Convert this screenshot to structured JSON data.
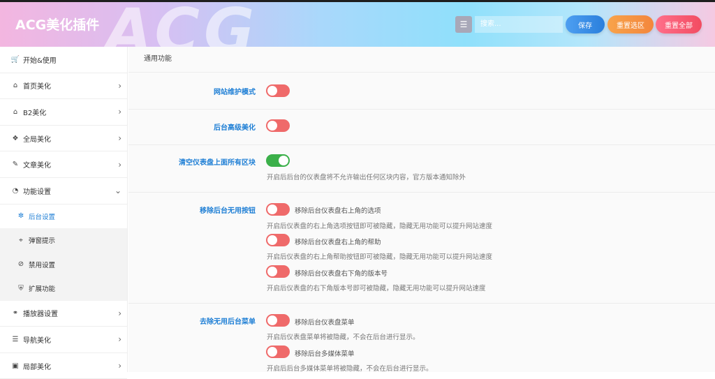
{
  "header": {
    "brand": "ACG美化插件",
    "watermark": "ACG",
    "search_placeholder": "搜索...",
    "menu_icon": "list-icon",
    "save_label": "保存",
    "reset_section_label": "重置选区",
    "reset_all_label": "重置全部"
  },
  "sidebar": {
    "items": [
      {
        "label": "开始&使用",
        "icon": "cart-icon"
      },
      {
        "label": "首页美化",
        "icon": "home-icon"
      },
      {
        "label": "B2美化",
        "icon": "home-icon"
      },
      {
        "label": "全局美化",
        "icon": "codepen-icon"
      },
      {
        "label": "文章美化",
        "icon": "edit-icon"
      },
      {
        "label": "功能设置",
        "icon": "pie-chart-icon"
      }
    ],
    "sub_items": [
      {
        "label": "后台设置",
        "icon": "spinner-icon",
        "active": true
      },
      {
        "label": "弹窗提示",
        "icon": "crop-icon"
      },
      {
        "label": "禁用设置",
        "icon": "ban-icon"
      },
      {
        "label": "扩展功能",
        "icon": "shield-icon"
      }
    ],
    "bottom_items": [
      {
        "label": "播放器设置",
        "icon": "headphones-icon"
      },
      {
        "label": "导航美化",
        "icon": "list-icon"
      },
      {
        "label": "局部美化",
        "icon": "frame-icon"
      }
    ]
  },
  "main": {
    "title": "通用功能",
    "settings": [
      {
        "label": "网站维护模式",
        "on": false
      },
      {
        "label": "后台高级美化",
        "on": false
      },
      {
        "label": "清空仪表盘上面所有区块",
        "on": true,
        "desc": "开启后后台的仪表盘将不允许输出任何区块内容，官方版本通知除外"
      },
      {
        "label": "移除后台无用按钮",
        "options": [
          {
            "text": "移除后台仪表盘右上角的选项",
            "desc": "开启后仪表盘的右上角选项按钮即可被隐藏，隐藏无用功能可以提升网站速度"
          },
          {
            "text": "移除后台仪表盘右上角的帮助",
            "desc": "开启后仪表盘的右上角帮助按钮即可被隐藏，隐藏无用功能可以提升网站速度"
          },
          {
            "text": "移除后台仪表盘右下角的版本号",
            "desc": "开启后仪表盘的右下角版本号即可被隐藏，隐藏无用功能可以提升网站速度"
          }
        ]
      },
      {
        "label": "去除无用后台菜单",
        "options": [
          {
            "text": "移除后台仪表盘菜单",
            "desc": "开启后仪表盘菜单将被隐藏，不会在后台进行显示。"
          },
          {
            "text": "移除后台多媒体菜单",
            "desc": "开启后后台多媒体菜单将被隐藏，不会在后台进行显示。"
          }
        ]
      }
    ]
  },
  "colors": {
    "accent": "#1f7fd5",
    "toggle_off": "#ef6a6a",
    "toggle_on": "#3bb04a"
  }
}
